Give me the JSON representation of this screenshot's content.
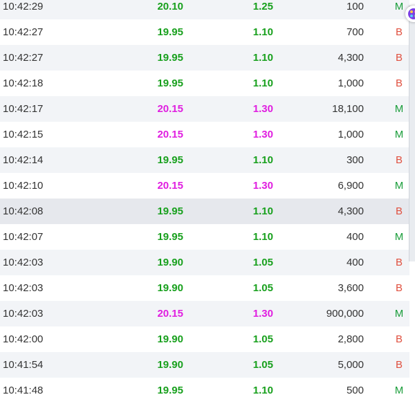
{
  "trades": [
    {
      "time": "10:42:29",
      "price": "20.10",
      "change": "1.25",
      "volume": "100",
      "side": "M",
      "price_color": "green"
    },
    {
      "time": "10:42:27",
      "price": "19.95",
      "change": "1.10",
      "volume": "700",
      "side": "B",
      "price_color": "green"
    },
    {
      "time": "10:42:27",
      "price": "19.95",
      "change": "1.10",
      "volume": "4,300",
      "side": "B",
      "price_color": "green"
    },
    {
      "time": "10:42:18",
      "price": "19.95",
      "change": "1.10",
      "volume": "1,000",
      "side": "B",
      "price_color": "green"
    },
    {
      "time": "10:42:17",
      "price": "20.15",
      "change": "1.30",
      "volume": "18,100",
      "side": "M",
      "price_color": "magenta"
    },
    {
      "time": "10:42:15",
      "price": "20.15",
      "change": "1.30",
      "volume": "1,000",
      "side": "M",
      "price_color": "magenta"
    },
    {
      "time": "10:42:14",
      "price": "19.95",
      "change": "1.10",
      "volume": "300",
      "side": "B",
      "price_color": "green"
    },
    {
      "time": "10:42:10",
      "price": "20.15",
      "change": "1.30",
      "volume": "6,900",
      "side": "M",
      "price_color": "magenta"
    },
    {
      "time": "10:42:08",
      "price": "19.95",
      "change": "1.10",
      "volume": "4,300",
      "side": "B",
      "price_color": "green"
    },
    {
      "time": "10:42:07",
      "price": "19.95",
      "change": "1.10",
      "volume": "400",
      "side": "M",
      "price_color": "green"
    },
    {
      "time": "10:42:03",
      "price": "19.90",
      "change": "1.05",
      "volume": "400",
      "side": "B",
      "price_color": "green"
    },
    {
      "time": "10:42:03",
      "price": "19.90",
      "change": "1.05",
      "volume": "3,600",
      "side": "B",
      "price_color": "green"
    },
    {
      "time": "10:42:03",
      "price": "20.15",
      "change": "1.30",
      "volume": "900,000",
      "side": "M",
      "price_color": "magenta"
    },
    {
      "time": "10:42:00",
      "price": "19.90",
      "change": "1.05",
      "volume": "2,800",
      "side": "B",
      "price_color": "green"
    },
    {
      "time": "10:41:54",
      "price": "19.90",
      "change": "1.05",
      "volume": "5,000",
      "side": "B",
      "price_color": "green"
    },
    {
      "time": "10:41:48",
      "price": "19.95",
      "change": "1.10",
      "volume": "500",
      "side": "M",
      "price_color": "green"
    }
  ],
  "colors": {
    "green": "#18a01d",
    "magenta": "#e01ee0",
    "side_buy": "#1a9d3a",
    "side_sell": "#e0503f"
  },
  "highlighted_row": 8,
  "side_icon": "app-launcher-icon"
}
